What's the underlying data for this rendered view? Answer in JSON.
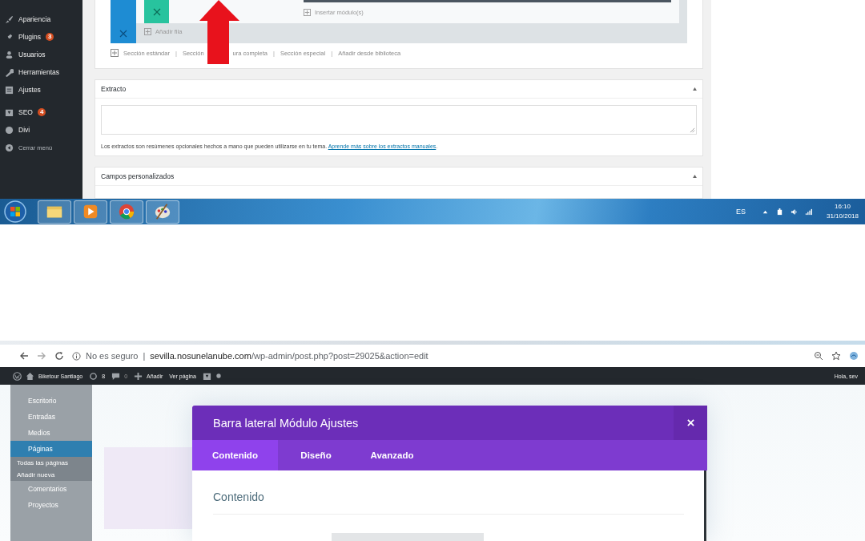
{
  "top": {
    "sidebar": {
      "items": [
        {
          "label": "Apariencia",
          "kind": "menu"
        },
        {
          "label": "Plugins",
          "kind": "menu",
          "badge": "3"
        },
        {
          "label": "Usuarios",
          "kind": "menu"
        },
        {
          "label": "Herramientas",
          "kind": "menu"
        },
        {
          "label": "Ajustes",
          "kind": "menu"
        },
        {
          "label": "SEO",
          "kind": "menu",
          "badge": "4"
        },
        {
          "label": "Divi",
          "kind": "menu"
        },
        {
          "label": "Cerrar menú",
          "kind": "collapse"
        }
      ]
    },
    "builder": {
      "insert_module": "Insertar módulo(s)",
      "add_row": "Añadir fila",
      "actions": [
        {
          "kind": "add",
          "label": "Sección estándar"
        },
        {
          "kind": "separator",
          "label": "|"
        },
        {
          "kind": "link",
          "label": "Sección"
        },
        {
          "kind": "gap"
        },
        {
          "kind": "link",
          "label": "ura completa"
        },
        {
          "kind": "separator",
          "label": "|"
        },
        {
          "kind": "link",
          "label": "Sección especial"
        },
        {
          "kind": "separator",
          "label": "|"
        },
        {
          "kind": "link",
          "label": "Añadir desde biblioteca"
        }
      ]
    },
    "excerpt": {
      "title": "Extracto",
      "help": "Los extractos son resúmenes opcionales hechos a mano que pueden utilizarse en tu tema.",
      "link": "Aprende más sobre los extractos manuales",
      "after": "."
    },
    "custom_fields": {
      "title": "Campos personalizados"
    }
  },
  "taskbar": {
    "apps": [
      {
        "kind": "folder"
      },
      {
        "kind": "media"
      },
      {
        "kind": "chrome"
      },
      {
        "kind": "paint"
      }
    ],
    "language": "ES",
    "time": "16:10",
    "date": "31/10/2018"
  },
  "browser": {
    "security": "No es seguro",
    "separator": "|",
    "domain": "sevilla.nosunelanube.com",
    "path": "/wp-admin/post.php?post=29025&action=edit"
  },
  "admin_bar": {
    "site": "Biketour Santiago",
    "updates": "8",
    "comments": "0",
    "new": "Añadir",
    "view": "Ver página",
    "greeting": "Hola, sev"
  },
  "faded_sidebar": {
    "items": [
      {
        "label": "Escritorio",
        "kind": "menu",
        "selected": false
      },
      {
        "label": "Entradas",
        "kind": "menu",
        "selected": false
      },
      {
        "label": "Medios",
        "kind": "menu",
        "selected": false
      },
      {
        "label": "Páginas",
        "kind": "menu",
        "selected": true
      },
      {
        "label": "Todas las páginas",
        "kind": "sub",
        "selected": false
      },
      {
        "label": "Añadir nueva",
        "kind": "sub",
        "selected": false
      },
      {
        "label": "Comentarios",
        "kind": "menu",
        "selected": false
      },
      {
        "label": "Proyectos",
        "kind": "menu",
        "selected": false
      }
    ]
  },
  "modal": {
    "title": "Barra lateral Módulo Ajustes",
    "tabs": [
      {
        "label": "Contenido",
        "selected": true
      },
      {
        "label": "Diseño",
        "selected": false
      },
      {
        "label": "Avanzado",
        "selected": false
      }
    ],
    "section": "Contenido"
  }
}
